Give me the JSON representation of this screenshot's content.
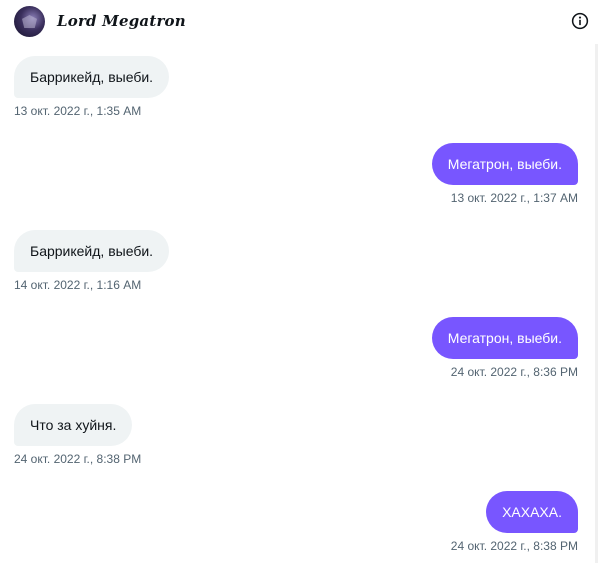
{
  "header": {
    "title": "Lord Megatron",
    "avatar_icon": "avatar-image",
    "info_icon": "info-icon"
  },
  "messages": [
    {
      "direction": "in",
      "text": "Баррикейд, выеби.",
      "timestamp": "13 окт. 2022 г., 1:35 AM"
    },
    {
      "direction": "out",
      "text": "Мегатрон, выеби.",
      "timestamp": "13 окт. 2022 г., 1:37 AM"
    },
    {
      "direction": "in",
      "text": "Баррикейд, выеби.",
      "timestamp": "14 окт. 2022 г., 1:16 AM"
    },
    {
      "direction": "out",
      "text": "Мегатрон, выеби.",
      "timestamp": "24 окт. 2022 г., 8:36 PM"
    },
    {
      "direction": "in",
      "text": "Что за хуйня.",
      "timestamp": "24 окт. 2022 г., 8:38 PM"
    },
    {
      "direction": "out",
      "text": "ХАХАХА.",
      "timestamp": "24 окт. 2022 г., 8:38 PM"
    }
  ],
  "colors": {
    "incoming_bubble": "#eff3f4",
    "outgoing_bubble": "#7856ff",
    "timestamp": "#536471",
    "text": "#0f1419"
  }
}
